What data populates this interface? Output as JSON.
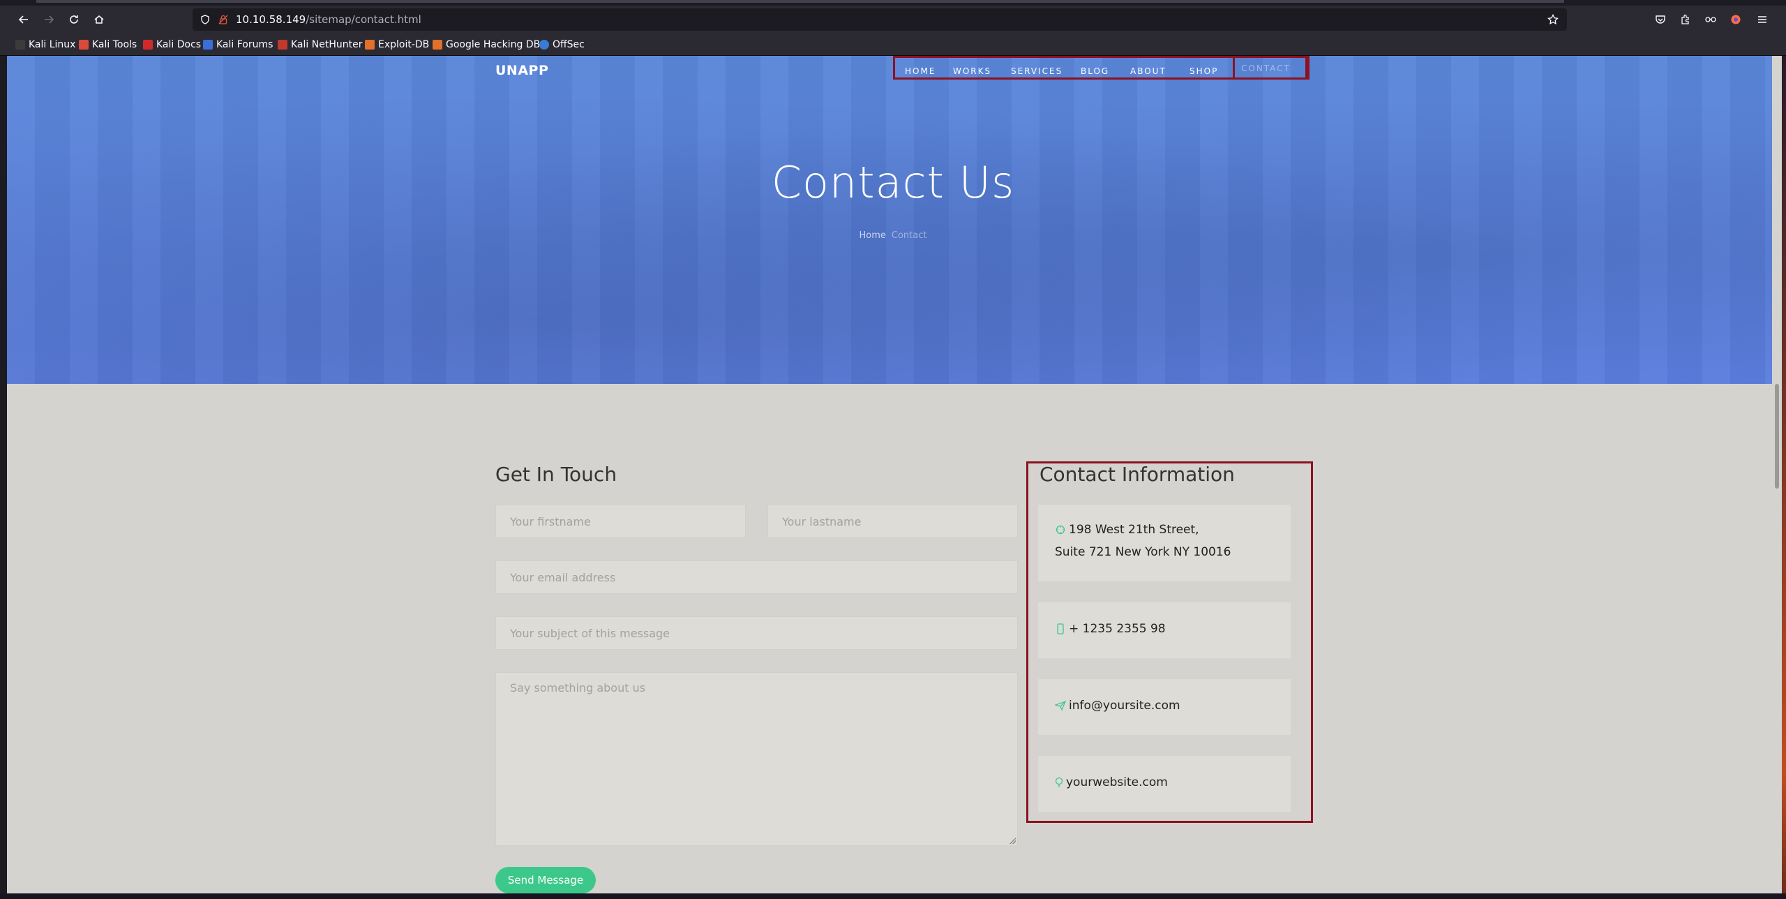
{
  "browser": {
    "url_host": "10.10.58.149",
    "url_path": "/sitemap/contact.html",
    "bookmarks": [
      {
        "label": "Kali Linux",
        "color": "#3b3b3b"
      },
      {
        "label": "Kali Tools",
        "color": "#d84a3a"
      },
      {
        "label": "Kali Docs",
        "color": "#d02a2a"
      },
      {
        "label": "Kali Forums",
        "color": "#3a6fd8"
      },
      {
        "label": "Kali NetHunter",
        "color": "#c0392b"
      },
      {
        "label": "Exploit-DB",
        "color": "#e0702a"
      },
      {
        "label": "Google Hacking DB",
        "color": "#e0702a"
      },
      {
        "label": "OffSec",
        "color": "#3a7bd5"
      }
    ]
  },
  "site": {
    "brand": "UNAPP",
    "menu": [
      "HOME",
      "WORKS",
      "SERVICES",
      "BLOG",
      "ABOUT",
      "SHOP",
      "CONTACT"
    ],
    "hero_title": "Contact Us",
    "breadcrumb_home": "Home",
    "breadcrumb_current": "Contact"
  },
  "form": {
    "title": "Get In Touch",
    "firstname_placeholder": "Your firstname",
    "lastname_placeholder": "Your lastname",
    "email_placeholder": "Your email address",
    "subject_placeholder": "Your subject of this message",
    "message_placeholder": "Say something about us",
    "send_label": "Send Message"
  },
  "info": {
    "title": "Contact Information",
    "address_line1": "198 West 21th Street,",
    "address_line2": "Suite 721 New York NY 10016",
    "phone": "+ 1235 2355 98",
    "email": "info@yoursite.com",
    "website": "yourwebsite.com"
  },
  "colors": {
    "accent_green": "#3cc88a",
    "hero_blue": "#5b82de",
    "highlight_red": "#8b1220"
  }
}
